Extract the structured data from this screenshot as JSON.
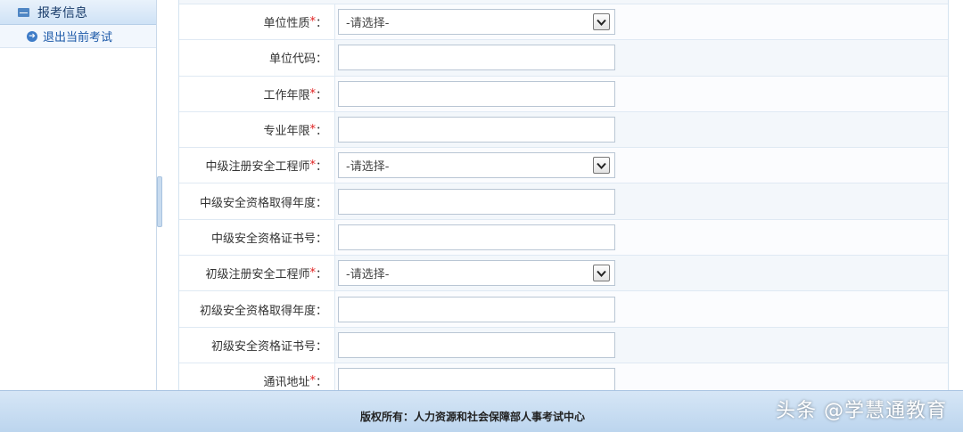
{
  "sidebar": {
    "header": "报考信息",
    "items": [
      {
        "label": "退出当前考试"
      }
    ]
  },
  "form": {
    "required_mark": "*",
    "rows": [
      {
        "label": "单位性质",
        "required": true,
        "type": "select",
        "value": "-请选择-"
      },
      {
        "label": "单位代码",
        "required": false,
        "type": "input",
        "value": ""
      },
      {
        "label": "工作年限",
        "required": true,
        "type": "input",
        "value": ""
      },
      {
        "label": "专业年限",
        "required": true,
        "type": "input",
        "value": ""
      },
      {
        "label": "中级注册安全工程师",
        "required": true,
        "type": "select",
        "value": "-请选择-"
      },
      {
        "label": "中级安全资格取得年度",
        "required": false,
        "type": "input",
        "value": ""
      },
      {
        "label": "中级安全资格证书号",
        "required": false,
        "type": "input",
        "value": ""
      },
      {
        "label": "初级注册安全工程师",
        "required": true,
        "type": "select",
        "value": "-请选择-"
      },
      {
        "label": "初级安全资格取得年度",
        "required": false,
        "type": "input",
        "value": ""
      },
      {
        "label": "初级安全资格证书号",
        "required": false,
        "type": "input",
        "value": ""
      },
      {
        "label": "通讯地址",
        "required": true,
        "type": "input",
        "value": ""
      }
    ]
  },
  "footer": {
    "copyright": "版权所有：人力资源和社会保障部人事考试中心"
  },
  "watermark": "头条 @学慧通教育",
  "colors": {
    "required": "#e02020",
    "link": "#1b58a8",
    "footer_bg": "#c9ddf2"
  }
}
